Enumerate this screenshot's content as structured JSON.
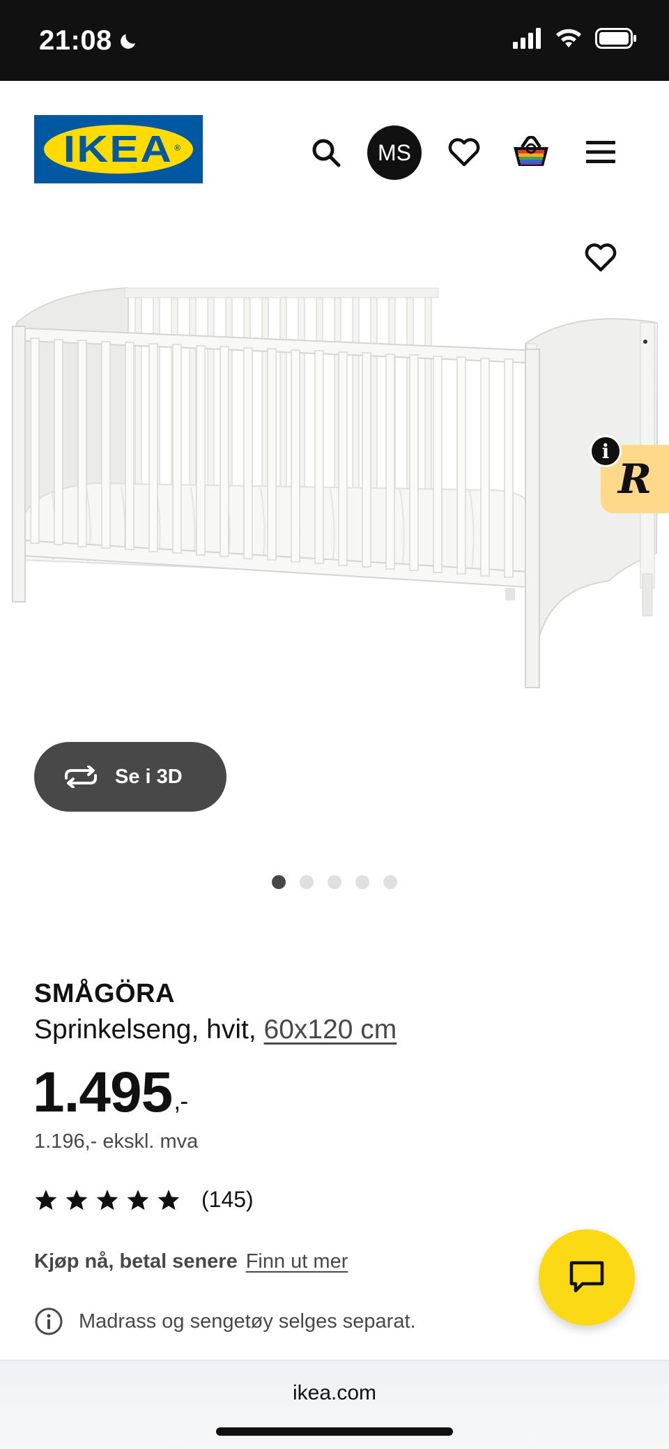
{
  "status_bar": {
    "time": "21:08",
    "moon_icon": "moon-icon",
    "signal_icon": "cellular-signal-icon",
    "wifi_icon": "wifi-icon",
    "battery_icon": "battery-icon"
  },
  "header": {
    "logo_text": "IKEA",
    "search_icon": "search-icon",
    "avatar_initials": "MS",
    "wishlist_icon": "heart-icon",
    "basket_icon": "basket-icon",
    "menu_icon": "hamburger-menu-icon"
  },
  "gallery": {
    "favorite_icon": "heart-icon",
    "view_3d_label": "Se i 3D",
    "dots_total": 5,
    "dots_active_index": 0,
    "widget_letter": "R",
    "widget_info": "i"
  },
  "product": {
    "name": "SMÅGÖRA",
    "description": "Sprinkelseng, hvit, ",
    "size_link": "60x120 cm",
    "price": "1.495",
    "price_suffix": ",-",
    "price_excl_vat": "1.196,- ekskl. mva",
    "rating_stars": 5,
    "rating_count": "(145)",
    "buy_now_label": "Kjøp nå, betal senere",
    "buy_now_link": "Finn ut mer",
    "notice": "Madrass og sengetøy selges separat."
  },
  "colors": {
    "ikea_blue": "#0058a3",
    "ikea_yellow": "#ffdb00",
    "chat_yellow": "#fbd914",
    "dark_button": "#484848"
  },
  "browser": {
    "url": "ikea.com"
  }
}
